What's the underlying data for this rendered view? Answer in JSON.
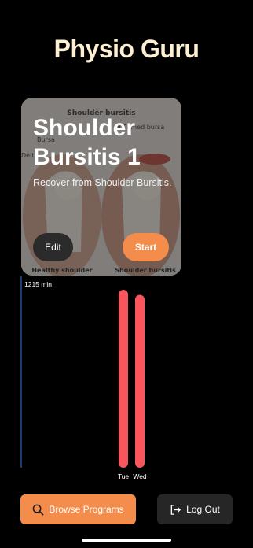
{
  "app": {
    "title": "Physio Guru"
  },
  "program_card": {
    "title": "Shoulder Bursitis 1",
    "subtitle": "Recover from Shoulder Bursitis.",
    "edit_label": "Edit",
    "start_label": "Start",
    "image_labels": {
      "top": "Shoulder bursitis",
      "bursa": "Bursa",
      "inflamed": "Inflamed bursa",
      "deltoid": "Delt",
      "left_caption": "Healthy shoulder",
      "right_caption": "Shoulder bursitis"
    }
  },
  "chart_data": {
    "type": "bar",
    "title": "",
    "xlabel": "",
    "ylabel": "",
    "max_label": "1215 min",
    "ylim": [
      0,
      1215
    ],
    "categories": [
      "Tue",
      "Wed"
    ],
    "values": [
      1215,
      1180
    ],
    "color": "#f8555d"
  },
  "actions": {
    "browse_label": "Browse Programs",
    "logout_label": "Log Out"
  },
  "colors": {
    "accent": "#f48d4b",
    "title": "#fcefd2",
    "bar": "#f8555d",
    "axis": "#3a7bd5"
  }
}
